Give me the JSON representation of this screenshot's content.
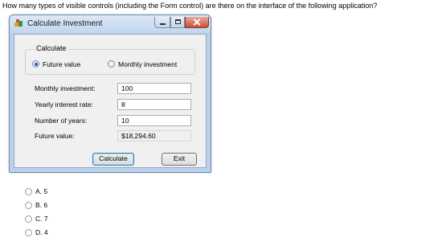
{
  "question": "How many types of visible controls (including the Form control) are there on the interface of the following application?",
  "window": {
    "title": "Calculate Investment",
    "buttons": {
      "minimize": "minimize",
      "maximize": "maximize",
      "close": "close"
    }
  },
  "group": {
    "label": "Calculate",
    "radios": [
      {
        "label": "Future value",
        "checked": true
      },
      {
        "label": "Monthly investment",
        "checked": false
      }
    ]
  },
  "fields": [
    {
      "label": "Monthly investment:",
      "value": "100"
    },
    {
      "label": "Yearly interest rate:",
      "value": "8"
    },
    {
      "label": "Number of years:",
      "value": "10"
    },
    {
      "label": "Future value:",
      "value": "$18,294.60"
    }
  ],
  "buttons": {
    "calculate": "Calculate",
    "exit": "Exit"
  },
  "answers": [
    {
      "label": "A. 5"
    },
    {
      "label": "B. 6"
    },
    {
      "label": "C. 7"
    },
    {
      "label": "D. 4"
    }
  ],
  "colors": {
    "accent": "#1e5fb4",
    "close_button": "#c9503d",
    "window_frame": "#b9d1ea"
  }
}
